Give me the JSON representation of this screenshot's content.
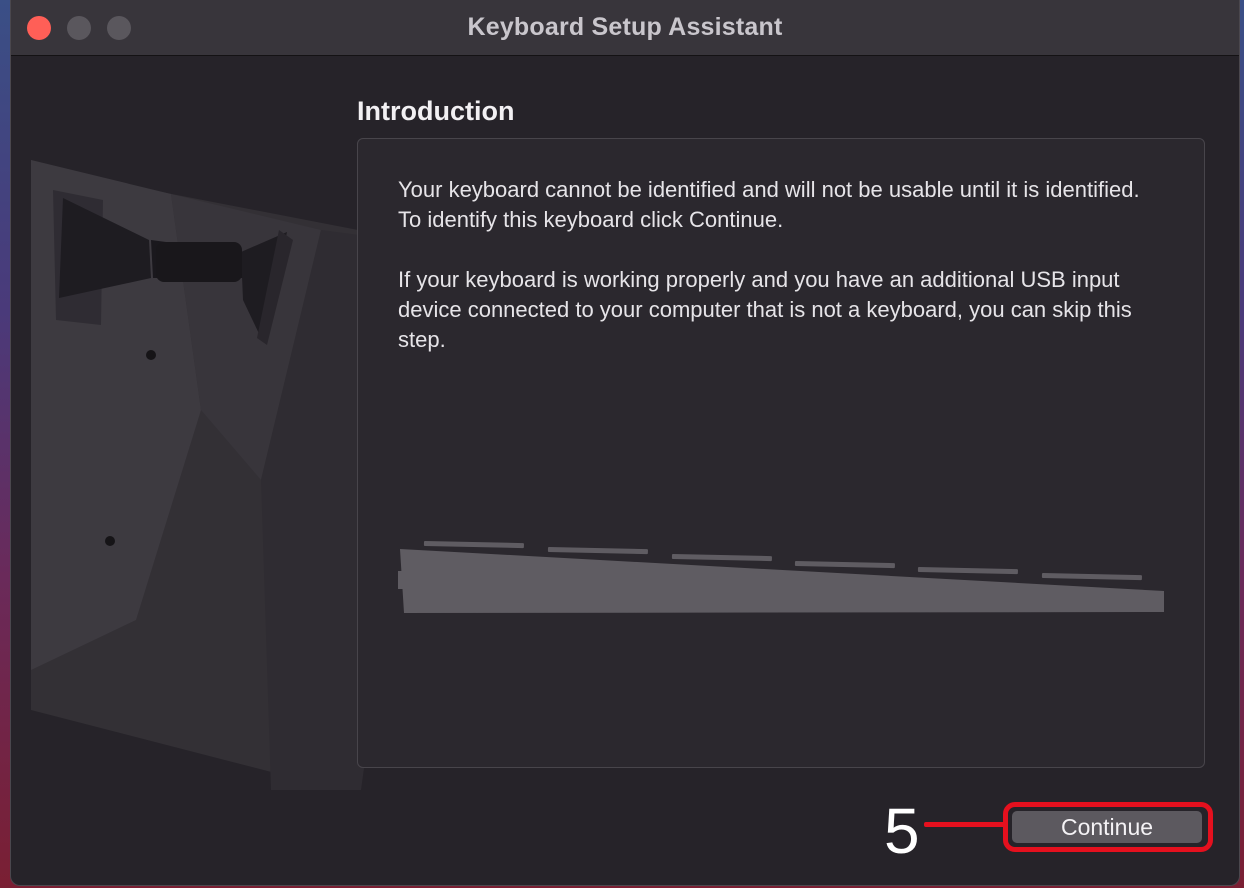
{
  "window": {
    "title": "Keyboard Setup Assistant"
  },
  "page": {
    "heading": "Introduction",
    "paragraph_1": "Your keyboard cannot be identified and will not be usable until it is identified. To identify this keyboard click Continue.",
    "paragraph_2": "If your keyboard is working properly and you have an additional USB input device connected to your computer that is not a keyboard, you can skip this step."
  },
  "buttons": {
    "continue_label": "Continue"
  },
  "annotation": {
    "number": "5",
    "color": "#e5101e"
  },
  "colors": {
    "close": "#ff5f57",
    "window_bg": "#262329",
    "panel_bg": "#2b282e"
  },
  "icons": {
    "illustration": "tuxedo-illustration",
    "keyboard": "keyboard-illustration"
  }
}
